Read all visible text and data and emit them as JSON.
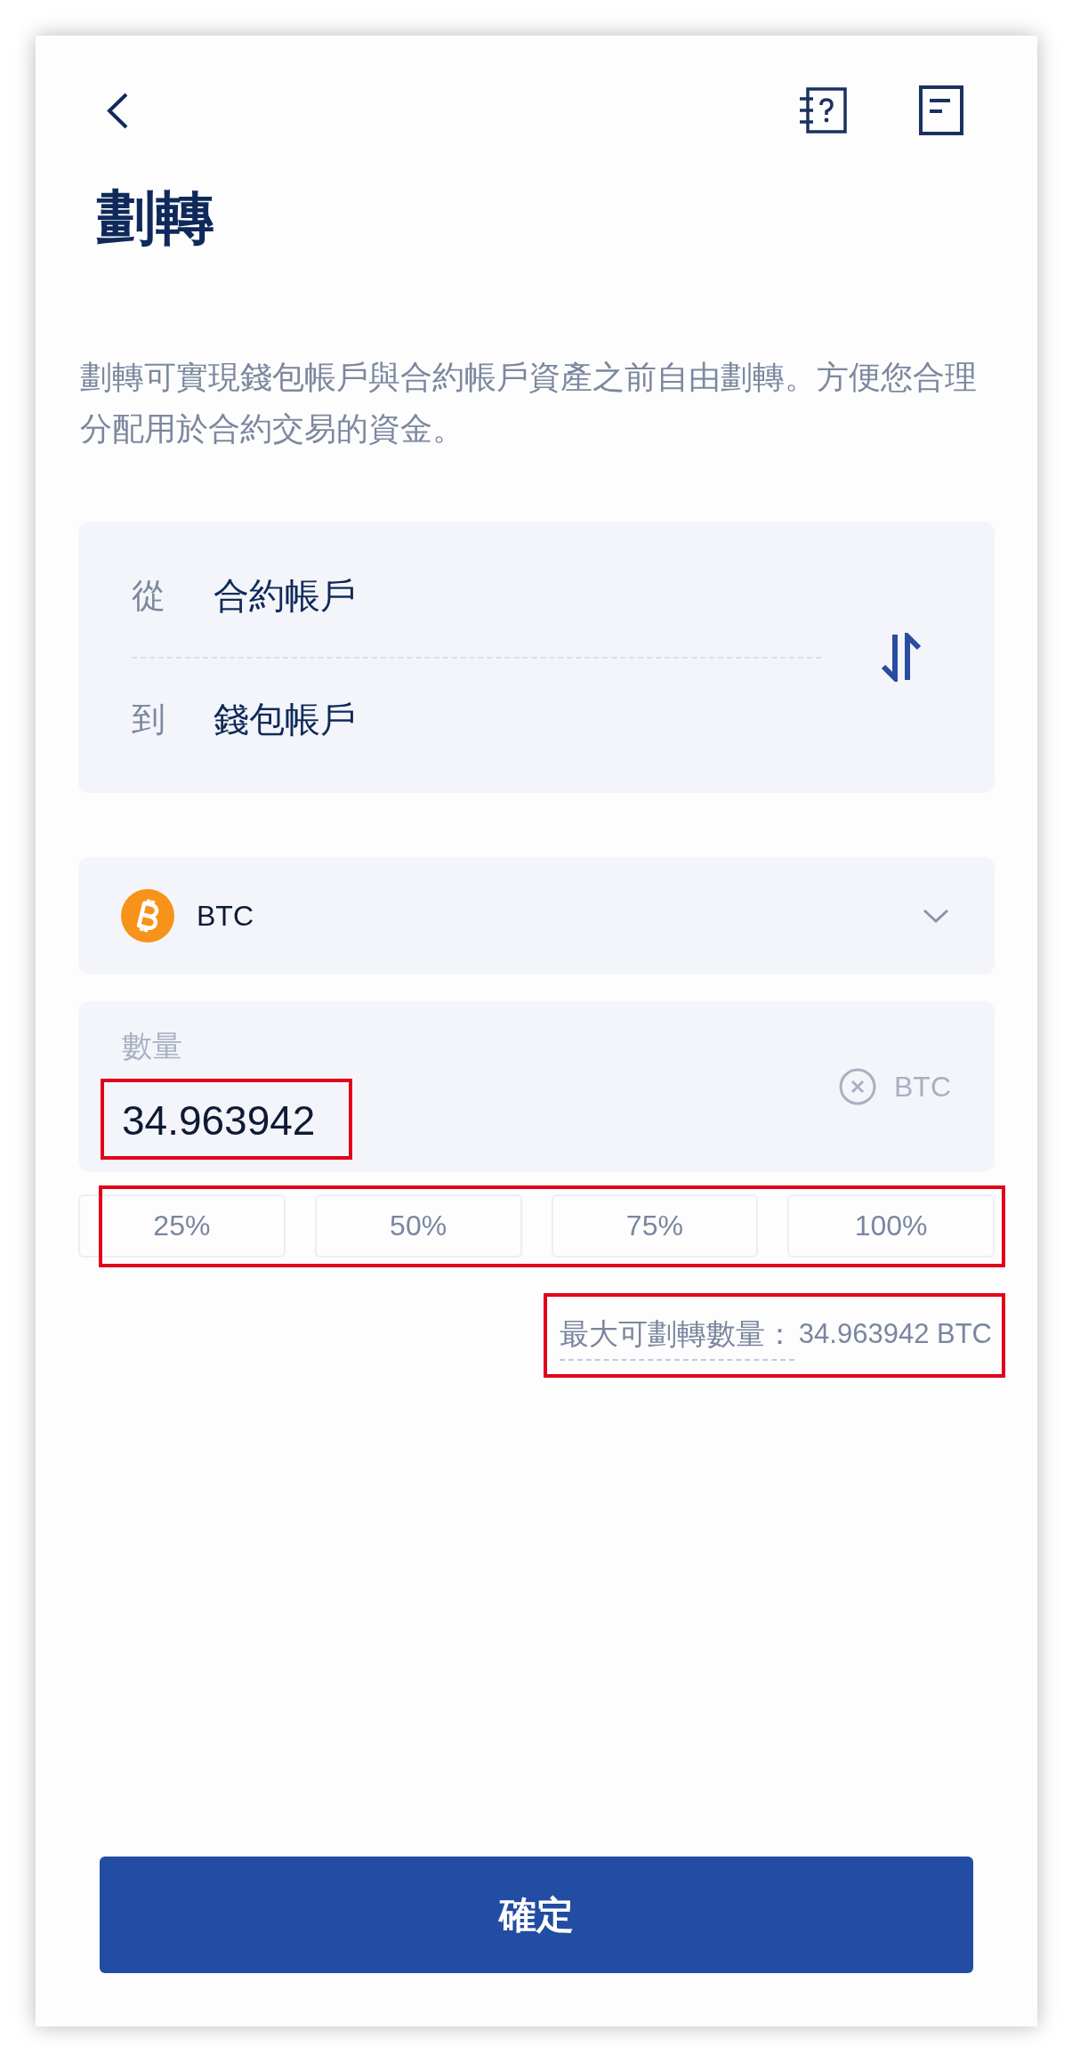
{
  "header": {
    "title": "劃轉"
  },
  "description": "劃轉可實現錢包帳戶與合約帳戶資產之前自由劃轉。方便您合理分配用於合約交易的資金。",
  "transfer": {
    "from": {
      "label": "從",
      "account": "合約帳戶"
    },
    "to": {
      "label": "到",
      "account": "錢包帳戶"
    }
  },
  "coin": {
    "symbol": "BTC"
  },
  "amount": {
    "label": "數量",
    "value": "34.963942",
    "unit": "BTC",
    "highlighted": true
  },
  "percent_buttons": {
    "highlighted": true,
    "items": [
      "25%",
      "50%",
      "75%",
      "100%"
    ]
  },
  "max_transferable": {
    "label": "最大可劃轉數量：",
    "value": "34.963942 BTC",
    "highlighted": true
  },
  "confirm_button": "確定"
}
